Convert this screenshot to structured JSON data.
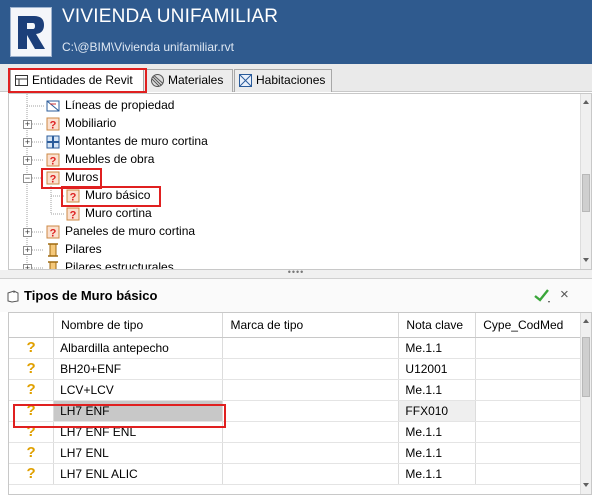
{
  "app": {
    "title": "VIVIENDA UNIFAMILIAR",
    "path": "C:\\@BIM\\Vivienda unifamiliar.rvt",
    "logo_letter": "R"
  },
  "tabs": [
    {
      "label": "Entidades de Revit",
      "icon": "revit-entities-icon",
      "active": true
    },
    {
      "label": "Materiales",
      "icon": "materials-icon",
      "active": false
    },
    {
      "label": "Habitaciones",
      "icon": "rooms-icon",
      "active": false
    }
  ],
  "tree": {
    "items": [
      {
        "label": "Líneas de propiedad",
        "level": 1,
        "expander": "",
        "icon": "property-lines-icon"
      },
      {
        "label": "Mobiliario",
        "level": 1,
        "expander": "+",
        "icon": "unknown-category-icon"
      },
      {
        "label": "Montantes de muro cortina",
        "level": 1,
        "expander": "+",
        "icon": "curtain-mullion-icon"
      },
      {
        "label": "Muebles de obra",
        "level": 1,
        "expander": "+",
        "icon": "unknown-category-icon"
      },
      {
        "label": "Muros",
        "level": 1,
        "expander": "−",
        "icon": "unknown-category-icon"
      },
      {
        "label": "Muro básico",
        "level": 2,
        "expander": "",
        "icon": "unknown-category-icon"
      },
      {
        "label": "Muro cortina",
        "level": 2,
        "expander": "",
        "icon": "unknown-category-icon"
      },
      {
        "label": "Paneles de muro cortina",
        "level": 1,
        "expander": "+",
        "icon": "unknown-category-icon"
      },
      {
        "label": "Pilares",
        "level": 1,
        "expander": "+",
        "icon": "column-icon"
      },
      {
        "label": "Pilares estructurales",
        "level": 1,
        "expander": "+",
        "icon": "column-icon"
      }
    ],
    "splitter_grip": "••••"
  },
  "panel": {
    "title": "Tipos de Muro básico",
    "accept_icon": "checkmark-icon",
    "cancel_label": "×"
  },
  "grid": {
    "columns": [
      "",
      "Nombre de tipo",
      "Marca de tipo",
      "Nota clave",
      "Cype_CodMed"
    ],
    "rows": [
      {
        "icon": "?",
        "name": "Albardilla antepecho",
        "mark": "",
        "key": "Me.1.1",
        "code": ""
      },
      {
        "icon": "?",
        "name": "BH20+ENF",
        "mark": "",
        "key": "U12001",
        "code": ""
      },
      {
        "icon": "?",
        "name": "LCV+LCV",
        "mark": "",
        "key": "Me.1.1",
        "code": ""
      },
      {
        "icon": "?",
        "name": "LH7 ENF",
        "mark": "",
        "key": "FFX010",
        "code": ""
      },
      {
        "icon": "?",
        "name": "LH7 ENF ENL",
        "mark": "",
        "key": "Me.1.1",
        "code": ""
      },
      {
        "icon": "?",
        "name": "LH7 ENL",
        "mark": "",
        "key": "Me.1.1",
        "code": ""
      },
      {
        "icon": "?",
        "name": "LH7 ENL ALIC",
        "mark": "",
        "key": "Me.1.1",
        "code": ""
      }
    ],
    "selected_row": 3
  },
  "colors": {
    "header_bg": "#2f5a8e",
    "highlight": "#e02020",
    "question_icon": "#e0a000",
    "accept_green": "#3aa63a"
  }
}
